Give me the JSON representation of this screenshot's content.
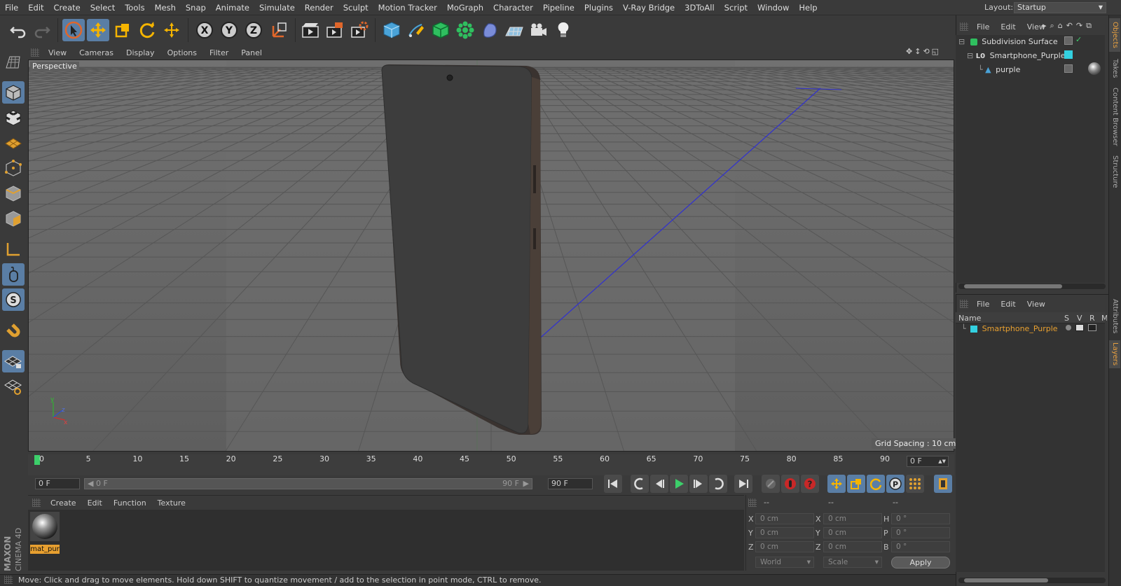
{
  "menubar": {
    "items": [
      "File",
      "Edit",
      "Create",
      "Select",
      "Tools",
      "Mesh",
      "Snap",
      "Animate",
      "Simulate",
      "Render",
      "Sculpt",
      "Motion Tracker",
      "MoGraph",
      "Character",
      "Pipeline",
      "Plugins",
      "V-Ray Bridge",
      "3DToAll",
      "Script",
      "Window",
      "Help"
    ],
    "layout_label": "Layout:",
    "layout_value": "Startup"
  },
  "toolbar": {
    "icons": [
      "undo-icon",
      "redo-icon",
      "live-selection-icon",
      "move-icon",
      "scale-icon",
      "rotate-icon",
      "transform-icon",
      "x-axis-icon",
      "y-axis-icon",
      "z-axis-icon",
      "coordinate-system-icon",
      "render-view-icon",
      "render-picture-viewer-icon",
      "edit-render-settings-icon",
      "cube-icon",
      "pen-icon",
      "subdivision-icon",
      "cloner-icon",
      "deformer-icon",
      "floor-icon",
      "camera-icon",
      "light-icon"
    ],
    "axis_labels": [
      "X",
      "Y",
      "Z"
    ]
  },
  "viewport": {
    "menu": [
      "View",
      "Cameras",
      "Display",
      "Options",
      "Filter",
      "Panel"
    ],
    "camera_label": "Perspective",
    "grid_spacing": "Grid Spacing : 10 cm"
  },
  "timeline": {
    "ticks": [
      "0",
      "5",
      "10",
      "15",
      "20",
      "25",
      "30",
      "35",
      "40",
      "45",
      "50",
      "55",
      "60",
      "65",
      "70",
      "75",
      "80",
      "85",
      "90"
    ],
    "current_frame": "0 F"
  },
  "playback": {
    "start_field": "0 F",
    "slider_start": "0 F",
    "slider_end": "90 F",
    "end_field": "90 F"
  },
  "material_manager": {
    "menu": [
      "Create",
      "Edit",
      "Function",
      "Texture"
    ],
    "materials": [
      {
        "name": "mat_pur"
      }
    ]
  },
  "coordinates": {
    "header": [
      "--",
      "--",
      "--"
    ],
    "position": {
      "x_label": "X",
      "x": "0 cm",
      "y_label": "Y",
      "y": "0 cm",
      "z_label": "Z",
      "z": "0 cm"
    },
    "size": {
      "x_label": "X",
      "x": "0 cm",
      "y_label": "Y",
      "y": "0 cm",
      "z_label": "Z",
      "z": "0 cm"
    },
    "rotation": {
      "h_label": "H",
      "h": "0 °",
      "p_label": "P",
      "p": "0 °",
      "b_label": "B",
      "b": "0 °"
    },
    "mode_select": "World",
    "size_select": "Scale",
    "apply_label": "Apply"
  },
  "objects_panel": {
    "menu": [
      "File",
      "Edit",
      "View"
    ],
    "tree": [
      {
        "name": "Subdivision Surface",
        "level": 0,
        "color": "#ffffff"
      },
      {
        "name": "Smartphone_Purple",
        "level": 1,
        "color": "#ffffff"
      },
      {
        "name": "purple",
        "level": 2,
        "color": "#ffffff"
      }
    ]
  },
  "layers_panel": {
    "menu": [
      "File",
      "Edit",
      "View"
    ],
    "columns": [
      "Name",
      "S",
      "V",
      "R",
      "M"
    ],
    "rows": [
      {
        "name": "Smartphone_Purple",
        "color": "#e8a030",
        "swatch": "#33d0e0"
      }
    ]
  },
  "right_tabs": [
    "Objects",
    "Takes",
    "Content Browser",
    "Structure",
    "Attributes",
    "Layers"
  ],
  "status": "Move: Click and drag to move elements. Hold down SHIFT to quantize movement / add to the selection in point mode, CTRL to remove.",
  "brand": {
    "line1": "MAXON",
    "line2": "CINEMA 4D"
  },
  "colors": {
    "accent": "#5a7ea5",
    "highlight": "#e8a030",
    "viewport": "#6a6a6a"
  }
}
